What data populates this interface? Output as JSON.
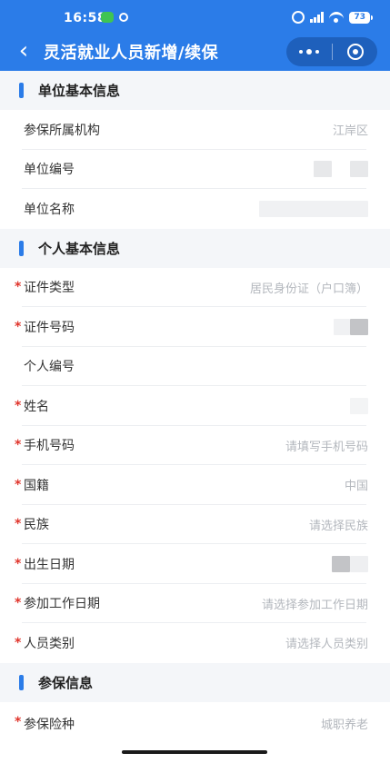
{
  "status_bar": {
    "time": "16:58",
    "battery": "73"
  },
  "nav": {
    "title": "灵活就业人员新增/续保"
  },
  "sections": {
    "unit": {
      "title": "单位基本信息",
      "fields": {
        "institution": {
          "label": "参保所属机构",
          "value": "江岸区"
        },
        "unit_code": {
          "label": "单位编号"
        },
        "unit_name": {
          "label": "单位名称"
        }
      }
    },
    "personal": {
      "title": "个人基本信息",
      "fields": {
        "id_type": {
          "label": "证件类型",
          "value": "居民身份证（户口簿）"
        },
        "id_number": {
          "label": "证件号码"
        },
        "personal_no": {
          "label": "个人编号"
        },
        "name": {
          "label": "姓名"
        },
        "phone": {
          "label": "手机号码",
          "placeholder": "请填写手机号码"
        },
        "nationality": {
          "label": "国籍",
          "value": "中国"
        },
        "ethnicity": {
          "label": "民族",
          "placeholder": "请选择民族"
        },
        "birth_date": {
          "label": "出生日期"
        },
        "work_start_date": {
          "label": "参加工作日期",
          "placeholder": "请选择参加工作日期"
        },
        "person_category": {
          "label": "人员类别",
          "placeholder": "请选择人员类别"
        }
      }
    },
    "insurance": {
      "title": "参保信息",
      "fields": {
        "insurance_type": {
          "label": "参保险种",
          "value": "城职养老"
        }
      }
    }
  },
  "required_mark": "*",
  "colors": {
    "primary": "#2b7ce8",
    "required": "#e0342b",
    "placeholder": "#b3b7bd"
  }
}
